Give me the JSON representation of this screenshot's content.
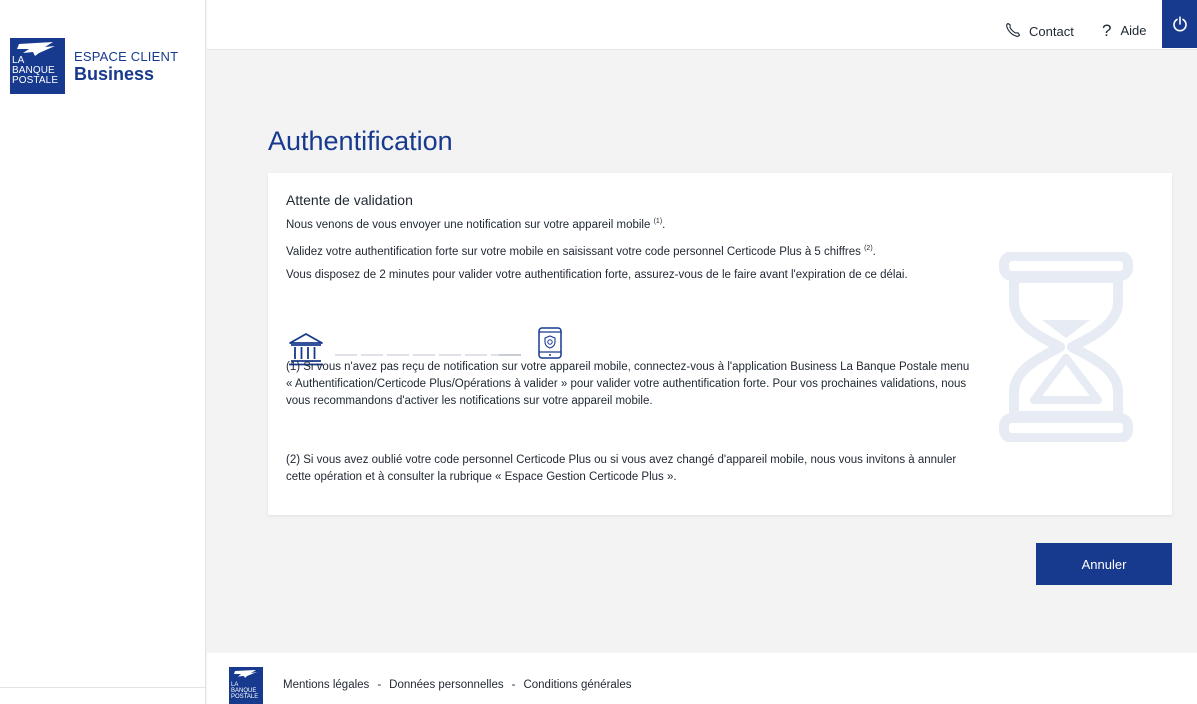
{
  "brand": {
    "logo_text": [
      "LA",
      "BANQUE",
      "POSTALE"
    ],
    "top": "ESPACE CLIENT",
    "bottom": "Business"
  },
  "header": {
    "contact_label": "Contact",
    "aide_label": "Aide",
    "contact_icon": "phone-icon",
    "aide_icon": "question-icon",
    "power_icon": "power-icon"
  },
  "main": {
    "title": "Authentification",
    "card": {
      "title": "Attente de validation",
      "p1": "Nous venons de vous envoyer une notification sur votre appareil mobile",
      "p1_sup": "(1)",
      "p1_end": ".",
      "p2": "Validez votre authentification forte sur votre mobile en saisissant votre code personnel Certicode Plus à 5 chiffres",
      "p2_sup": "(2)",
      "p2_end": ".",
      "p3": "Vous disposez de 2 minutes pour valider votre authentification forte, assurez-vous de le faire avant l'expiration de ce délai.",
      "note1": "(1) Si vous n'avez pas reçu de notification sur votre appareil mobile, connectez-vous à l'application Business La Banque Postale menu «  Authentification/Certicode Plus/Opérations à valider » pour valider votre authentification forte. Pour vos prochaines validations, nous vous recommandons d'activer les notifications sur votre appareil mobile.",
      "note2": "(2) Si vous avez oublié votre code personnel Certicode Plus ou si vous avez changé d'appareil mobile, nous vous invitons à annuler cette opération et à consulter la rubrique « Espace Gestion Certicode Plus »."
    },
    "cancel_label": "Annuler"
  },
  "footer": {
    "logo_text": [
      "LA",
      "BANQUE",
      "POSTALE"
    ],
    "links": [
      "Mentions légales",
      "Données personnelles",
      "Conditions générales"
    ],
    "separator": "-"
  },
  "colors": {
    "brand_blue": "#173a8e",
    "background": "#f3f3f3",
    "hourglass": "#e6ebf4"
  }
}
